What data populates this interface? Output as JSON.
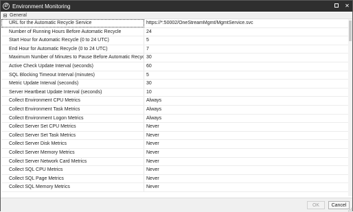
{
  "window": {
    "title": "Environment Monitoring",
    "icon": "onestream-logo-icon"
  },
  "group": {
    "label": "General"
  },
  "rows": [
    {
      "name": "URL for the Automatic Recycle Service",
      "value": "https://*:50002/OneStreamMgmt/MgmtService.svc"
    },
    {
      "name": "Number of Running Hours Before Automatic Recycle",
      "value": "24"
    },
    {
      "name": "Start Hour for Automatic Recycle (0 to 24 UTC)",
      "value": "5"
    },
    {
      "name": "End Hour for Automatic Recycle (0 to 24 UTC)",
      "value": "7"
    },
    {
      "name": "Maximum Number of Minutes to Pause Before Automatic Recycle",
      "value": "30"
    },
    {
      "name": "Active Check Update Interval (seconds)",
      "value": "60"
    },
    {
      "name": "SQL Blocking Timeout Interval (minutes)",
      "value": "5"
    },
    {
      "name": "Metric Update Interval (seconds)",
      "value": "30"
    },
    {
      "name": "Server Heartbeat Update Interval (seconds)",
      "value": "10"
    },
    {
      "name": "Collect Environment CPU Metrics",
      "value": "Always"
    },
    {
      "name": "Collect Environment Task Metrics",
      "value": "Always"
    },
    {
      "name": "Collect Environment Logon Metrics",
      "value": "Always"
    },
    {
      "name": "Collect Server Set CPU Metrics",
      "value": "Never"
    },
    {
      "name": "Collect Server Set Task Metrics",
      "value": "Never"
    },
    {
      "name": "Collect Server Disk Metrics",
      "value": "Never"
    },
    {
      "name": "Collect Server Memory Metrics",
      "value": "Never"
    },
    {
      "name": "Collect Server Network Card Metrics",
      "value": "Never"
    },
    {
      "name": "Collect SQL CPU Metrics",
      "value": "Never"
    },
    {
      "name": "Collect SQL Page Metrics",
      "value": "Never"
    },
    {
      "name": "Collect SQL Memory Metrics",
      "value": "Never"
    }
  ],
  "footer": {
    "ok_label": "OK",
    "cancel_label": "Cancel"
  }
}
